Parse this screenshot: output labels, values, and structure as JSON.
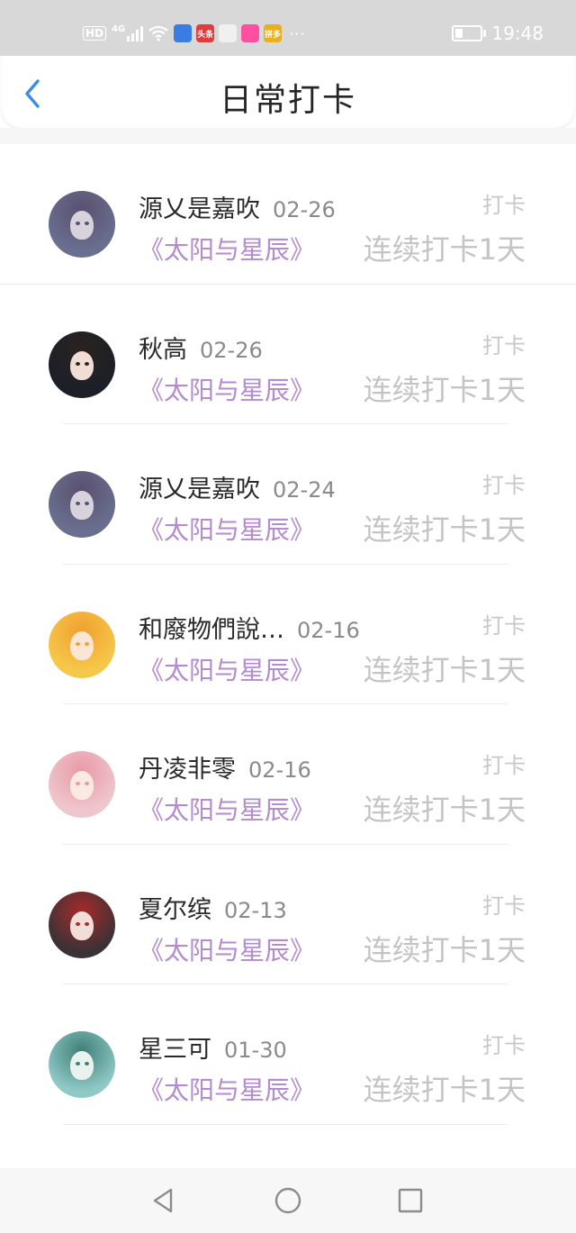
{
  "status_bar": {
    "hd": "HD",
    "network": "4G",
    "app_icons": [
      {
        "name": "music-app-icon",
        "color": "#3a7de0",
        "label": ""
      },
      {
        "name": "toutiao-app-icon",
        "color": "#e23b3b",
        "label": "头条"
      },
      {
        "name": "map-pin-app-icon",
        "color": "#f0f0f0",
        "label": ""
      },
      {
        "name": "video-app-icon",
        "color": "#ff4fa0",
        "label": ""
      },
      {
        "name": "shopping-app-icon",
        "color": "#e8b020",
        "label": "拼多"
      }
    ],
    "time": "19:48"
  },
  "header": {
    "title": "日常打卡"
  },
  "items": [
    {
      "name": "源乂是嘉吹",
      "date": "02-26",
      "action": "打卡",
      "book": "《太阳与星辰》",
      "streak": "连续打卡1天",
      "avatar": {
        "bg": "#6a6f8f",
        "face": "#d8d2dc",
        "hair": "#5a5070"
      }
    },
    {
      "name": "秋高",
      "date": "02-26",
      "action": "打卡",
      "book": "《太阳与星辰》",
      "streak": "连续打卡1天",
      "avatar": {
        "bg": "#1c1f28",
        "face": "#f2dcd6",
        "hair": "#2a2320"
      }
    },
    {
      "name": "源乂是嘉吹",
      "date": "02-24",
      "action": "打卡",
      "book": "《太阳与星辰》",
      "streak": "连续打卡1天",
      "avatar": {
        "bg": "#6a6f8f",
        "face": "#d8d2dc",
        "hair": "#5a5070"
      }
    },
    {
      "name": "和廢物們說…",
      "date": "02-16",
      "action": "打卡",
      "book": "《太阳与星辰》",
      "streak": "连续打卡1天",
      "avatar": {
        "bg": "#f6c84a",
        "face": "#fbe6d6",
        "hair": "#f0a030"
      }
    },
    {
      "name": "丹凌非零",
      "date": "02-16",
      "action": "打卡",
      "book": "《太阳与星辰》",
      "streak": "连续打卡1天",
      "avatar": {
        "bg": "#eec7cc",
        "face": "#fbe9e4",
        "hair": "#e89aa8"
      }
    },
    {
      "name": "夏尔缤",
      "date": "02-13",
      "action": "打卡",
      "book": "《太阳与星辰》",
      "streak": "连续打卡1天",
      "avatar": {
        "bg": "#3a3236",
        "face": "#f1ded8",
        "hair": "#a62a2a"
      }
    },
    {
      "name": "星三可",
      "date": "01-30",
      "action": "打卡",
      "book": "《太阳与星辰》",
      "streak": "连续打卡1天",
      "avatar": {
        "bg": "#8fc9c6",
        "face": "#e9f2ee",
        "hair": "#3f7f76"
      }
    }
  ],
  "colors": {
    "accent": "#3a8ee6",
    "book_title": "#b48ad0",
    "muted": "#c4c4c4"
  }
}
